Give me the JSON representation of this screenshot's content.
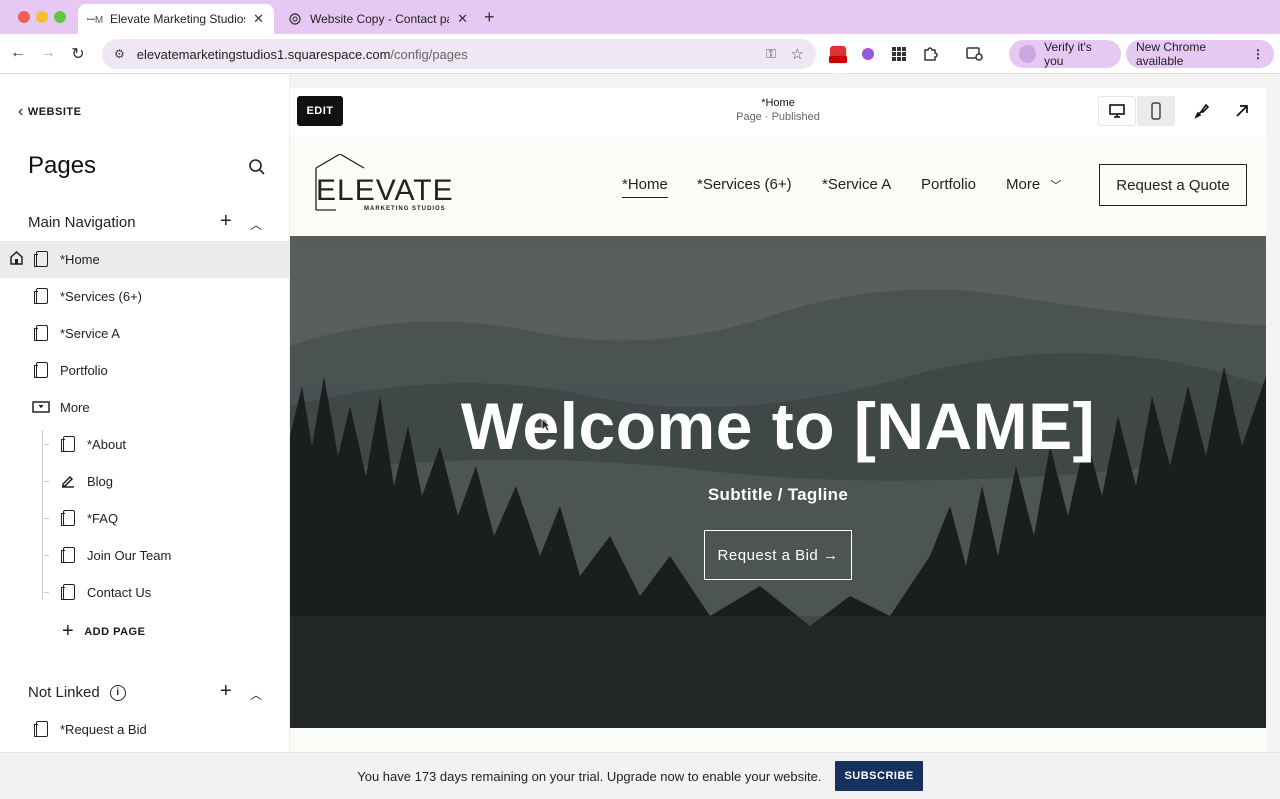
{
  "browser": {
    "tabs": [
      {
        "title": "Elevate Marketing Studios |",
        "favicon": "squarespace-icon",
        "active": true
      },
      {
        "title": "Website Copy - Contact page",
        "favicon": "chatgpt-icon",
        "active": false
      }
    ],
    "url_host": "elevatemarketingstudios1.squarespace.com",
    "url_path": "/config/pages",
    "verify_label": "Verify it's you",
    "update_label": "New Chrome available",
    "new_badge": "New"
  },
  "sidebar": {
    "back_label": "WEBSITE",
    "title": "Pages",
    "main_nav_title": "Main Navigation",
    "main_items": [
      {
        "label": "*Home"
      },
      {
        "label": "*Services (6+)"
      },
      {
        "label": "*Service A"
      },
      {
        "label": "Portfolio"
      },
      {
        "label": "More"
      }
    ],
    "more_items": [
      {
        "label": "*About"
      },
      {
        "label": "Blog"
      },
      {
        "label": "*FAQ"
      },
      {
        "label": "Join Our Team"
      },
      {
        "label": "Contact Us"
      }
    ],
    "add_page_label": "ADD PAGE",
    "not_linked_title": "Not Linked",
    "not_linked_items": [
      {
        "label": "*Request a Bid"
      }
    ]
  },
  "editor": {
    "edit_label": "EDIT",
    "page_name": "*Home",
    "page_status": "Page · Published"
  },
  "site": {
    "logo_text": "ELEVATE",
    "logo_sub": "MARKETING STUDIOS",
    "nav": [
      {
        "label": "*Home"
      },
      {
        "label": "*Services (6+)"
      },
      {
        "label": "*Service A"
      },
      {
        "label": "Portfolio"
      },
      {
        "label": "More"
      }
    ],
    "quote_label": "Request a Quote",
    "hero_title": "Welcome to [NAME]",
    "hero_subtitle": "Subtitle / Tagline",
    "hero_button": "Request a Bid →"
  },
  "trial": {
    "message": "You have 173 days remaining on your trial. Upgrade now to enable your website.",
    "button": "SUBSCRIBE"
  },
  "colors": {
    "chrome_accent": "#e6c9f2",
    "subscribe_bg": "#16315e",
    "edit_bg": "#111111"
  }
}
